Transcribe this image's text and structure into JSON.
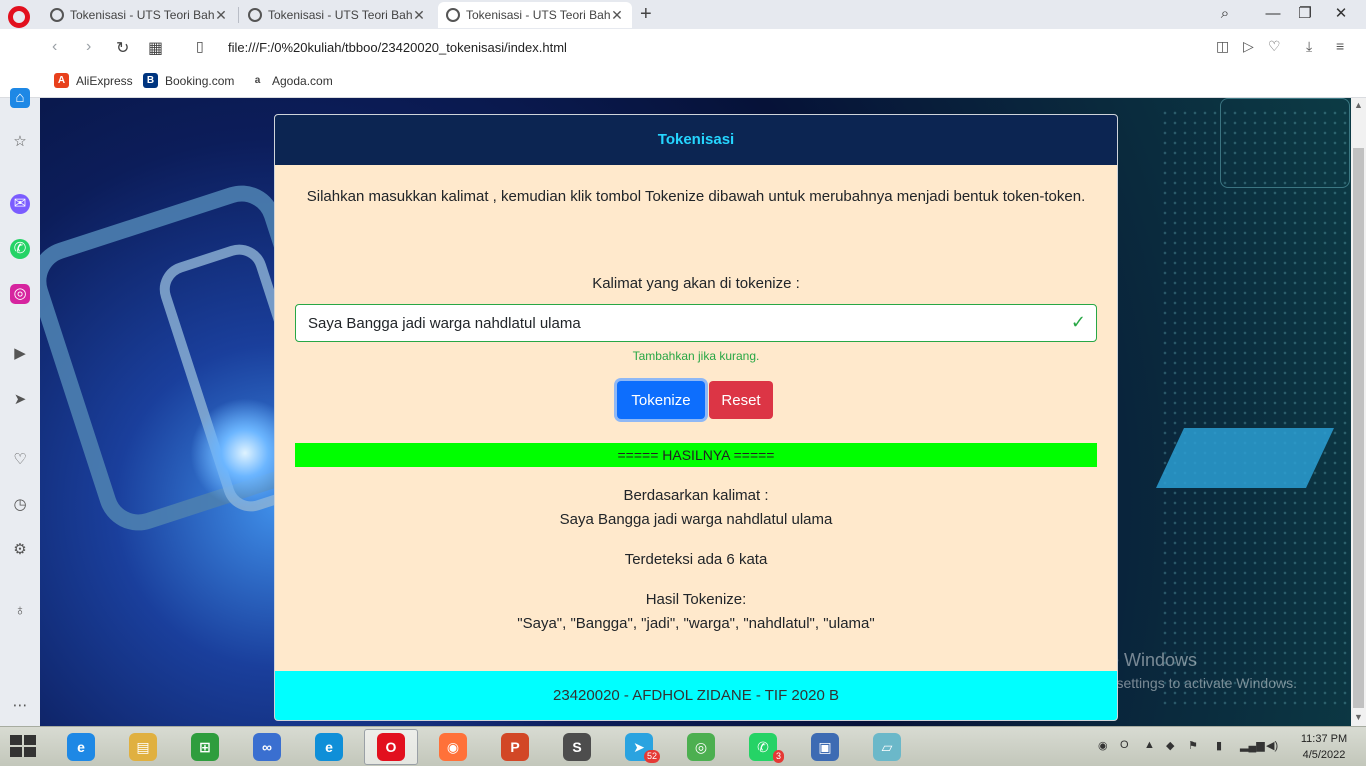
{
  "browser": {
    "tabs": [
      {
        "label": "Tokenisasi - UTS Teori Baha",
        "active": false
      },
      {
        "label": "Tokenisasi - UTS Teori Baha",
        "active": false
      },
      {
        "label": "Tokenisasi - UTS Teori Baha",
        "active": true
      }
    ],
    "url": "file:///F:/0%20kuliah/tbboo/23420020_tokenisasi/index.html",
    "bookmarks": [
      {
        "label": "AliExpress",
        "icon": "aliexpress-icon",
        "color": "#e8401c"
      },
      {
        "label": "Booking.com",
        "icon": "booking-icon",
        "color": "#003580"
      },
      {
        "label": "Agoda.com",
        "icon": "agoda-icon",
        "color": "#ffffff"
      }
    ]
  },
  "page": {
    "header_title": "Tokenisasi",
    "intro": "Silahkan masukkan kalimat , kemudian klik tombol Tokenize dibawah untuk merubahnya menjadi bentuk token-token.",
    "input_label": "Kalimat yang akan di tokenize :",
    "input_value": "Saya Bangga jadi warga nahdlatul ulama",
    "help_text": "Tambahkan jika kurang.",
    "tokenize_label": "Tokenize",
    "reset_label": "Reset",
    "result_header": "===== HASILNYA =====",
    "based_on_label": "Berdasarkan kalimat :",
    "based_on_value": "Saya Bangga jadi warga nahdlatul ulama",
    "word_count": "Terdeteksi ada 6 kata",
    "tokens_label": "Hasil Tokenize:",
    "tokens_value": "\"Saya\", \"Bangga\", \"jadi\", \"warga\", \"nahdlatul\", \"ulama\"",
    "footer": "23420020 - AFDHOL ZIDANE - TIF 2020 B"
  },
  "watermark": {
    "line1": "Activate Windows",
    "line2": "Go to PC settings to activate Windows."
  },
  "colors": {
    "header_bg": "#0c2552",
    "header_text": "#25d5ff",
    "card_bg": "#ffe9cc",
    "result_bar": "#00ff00",
    "footer_bg": "#00ffff",
    "valid_green": "#28a745",
    "primary": "#0d6efd",
    "danger": "#dc3545"
  },
  "taskbar": {
    "apps": [
      {
        "name": "internet-explorer-icon",
        "color": "#1e88e5",
        "glyph": "e"
      },
      {
        "name": "file-explorer-icon",
        "color": "#e0b040",
        "glyph": "▤"
      },
      {
        "name": "store-icon",
        "color": "#2e9d3d",
        "glyph": "⊞"
      },
      {
        "name": "infinity-app-icon",
        "color": "#3a6fd0",
        "glyph": "∞"
      },
      {
        "name": "edge-icon",
        "color": "#0f8fd8",
        "glyph": "e"
      },
      {
        "name": "opera-icon",
        "color": "#e2101e",
        "glyph": "O"
      },
      {
        "name": "firefox-icon",
        "color": "#ff7139",
        "glyph": "◉"
      },
      {
        "name": "powerpoint-icon",
        "color": "#d24726",
        "glyph": "P"
      },
      {
        "name": "sublime-icon",
        "color": "#4d4d4d",
        "glyph": "S"
      },
      {
        "name": "telegram-icon",
        "color": "#2aa3e0",
        "glyph": "➤"
      },
      {
        "name": "chrome-icon",
        "color": "#4caf50",
        "glyph": "◎"
      },
      {
        "name": "whatsapp-icon",
        "color": "#25d366",
        "glyph": "✆"
      },
      {
        "name": "virtualbox-icon",
        "color": "#3d6bb3",
        "glyph": "▣"
      },
      {
        "name": "notes-icon",
        "color": "#6bb8c9",
        "glyph": "▱"
      }
    ],
    "badges": {
      "telegram": "52",
      "whatsapp": "3"
    },
    "clock_time": "11:37 PM",
    "clock_date": "4/5/2022"
  }
}
